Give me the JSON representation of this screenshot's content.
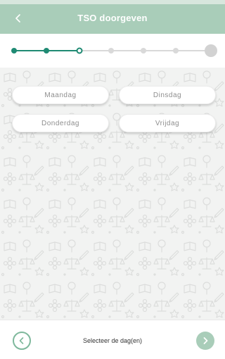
{
  "header": {
    "title": "TSO doorgeven",
    "back_icon": "chevron-left-icon"
  },
  "stepper": {
    "total_steps": 7,
    "current_step": 3,
    "completed_steps": 2,
    "colors": {
      "active": "#1f8a73",
      "inactive": "#d9d9d9",
      "last": "#cfcfcf"
    }
  },
  "days": [
    {
      "label": "Maandag"
    },
    {
      "label": "Dinsdag"
    },
    {
      "label": "Donderdag"
    },
    {
      "label": "Vrijdag"
    }
  ],
  "footer": {
    "status_text": "Selecteer de dag(en)",
    "prev_icon": "chevron-left-circle-icon",
    "next_icon": "chevron-right-circle-icon",
    "accent": "#a9cdb9"
  }
}
